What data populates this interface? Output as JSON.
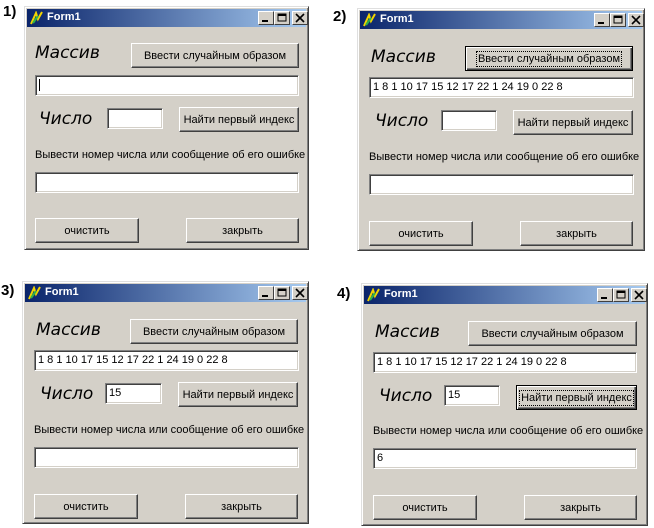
{
  "steps": [
    {
      "label": "1)",
      "title": "Form1",
      "massiv_label": "Массив",
      "chislo_label": "Число",
      "random_button": "Ввести случайным образом",
      "find_button": "Найти первый индекс",
      "array_value": "",
      "number_value": "",
      "result_caption": "Вывести номер числа или сообщение об его ошибке",
      "result_value": "",
      "clear_button": "очистить",
      "close_button": "закрыть"
    },
    {
      "label": "2)",
      "title": "Form1",
      "massiv_label": "Массив",
      "chislo_label": "Число",
      "random_button": "Ввести случайным образом",
      "find_button": "Найти первый индекс",
      "array_value": "1 8 1 10 17 15 12 17 22 1 24 19 0 22 8",
      "number_value": "",
      "result_caption": "Вывести номер числа или сообщение об его ошибке",
      "result_value": "",
      "clear_button": "очистить",
      "close_button": "закрыть"
    },
    {
      "label": "3)",
      "title": "Form1",
      "massiv_label": "Массив",
      "chislo_label": "Число",
      "random_button": "Ввести случайным образом",
      "find_button": "Найти первый индекс",
      "array_value": "1 8 1 10 17 15 12 17 22 1 24 19 0 22 8",
      "number_value": "15",
      "result_caption": "Вывести номер числа или сообщение об его ошибке",
      "result_value": "",
      "clear_button": "очистить",
      "close_button": "закрыть"
    },
    {
      "label": "4)",
      "title": "Form1",
      "massiv_label": "Массив",
      "chislo_label": "Число",
      "random_button": "Ввести случайным образом",
      "find_button": "Найти первый индекс",
      "array_value": "1 8 1 10 17 15 12 17 22 1 24 19 0 22 8",
      "number_value": "15",
      "result_caption": "Вывести номер числа или сообщение об его ошибке",
      "result_value": "6",
      "clear_button": "очистить",
      "close_button": "закрыть"
    }
  ],
  "icons": {
    "app": "delphi-app-icon",
    "minimize": "minimize-icon",
    "maximize": "maximize-icon",
    "close": "close-icon"
  },
  "colors": {
    "titlebar_start": "#0a246a",
    "titlebar_end": "#a6caf0",
    "window_face": "#d4d0c8"
  }
}
